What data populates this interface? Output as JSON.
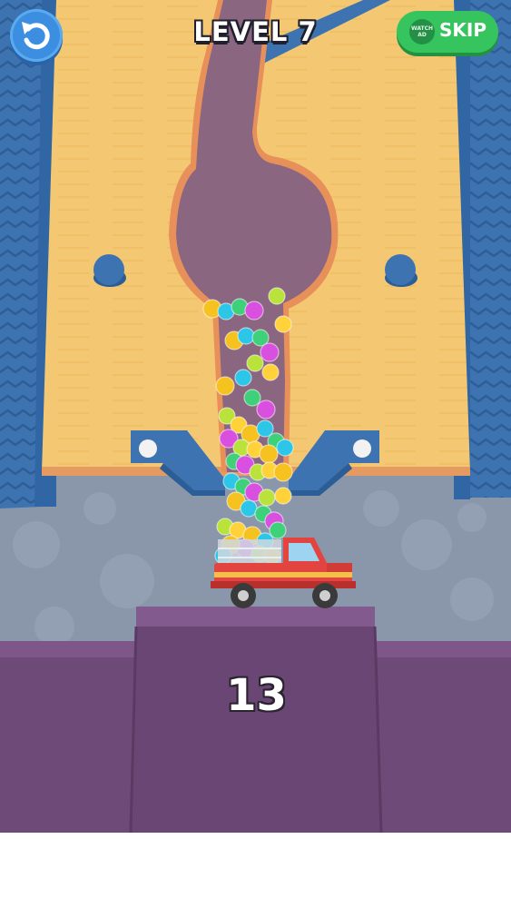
{
  "hud": {
    "level_title": "LEVEL 7",
    "restart_icon": "restart-arrow-icon",
    "skip": {
      "label": "SKIP",
      "badge_text": "WATCH AD",
      "badge_icon": "watch-ad-icon"
    }
  },
  "truck": {
    "ball_count": "13"
  },
  "colors": {
    "sand": "#f4c873",
    "sand_edge": "#e8905a",
    "dug_tunnel": "#8b6680",
    "wall_blue": "#3c73b0",
    "floor": "#8a96aa",
    "platform_purple": "#6e4a78",
    "truck_red": "#e2453f",
    "skip_green": "#35c45e",
    "restart_blue": "#3c8fe0"
  },
  "ball_colors": [
    "#f6c21f",
    "#2cc6e8",
    "#3fd17a",
    "#d94fe0",
    "#b9e33a",
    "#ffd23a"
  ]
}
